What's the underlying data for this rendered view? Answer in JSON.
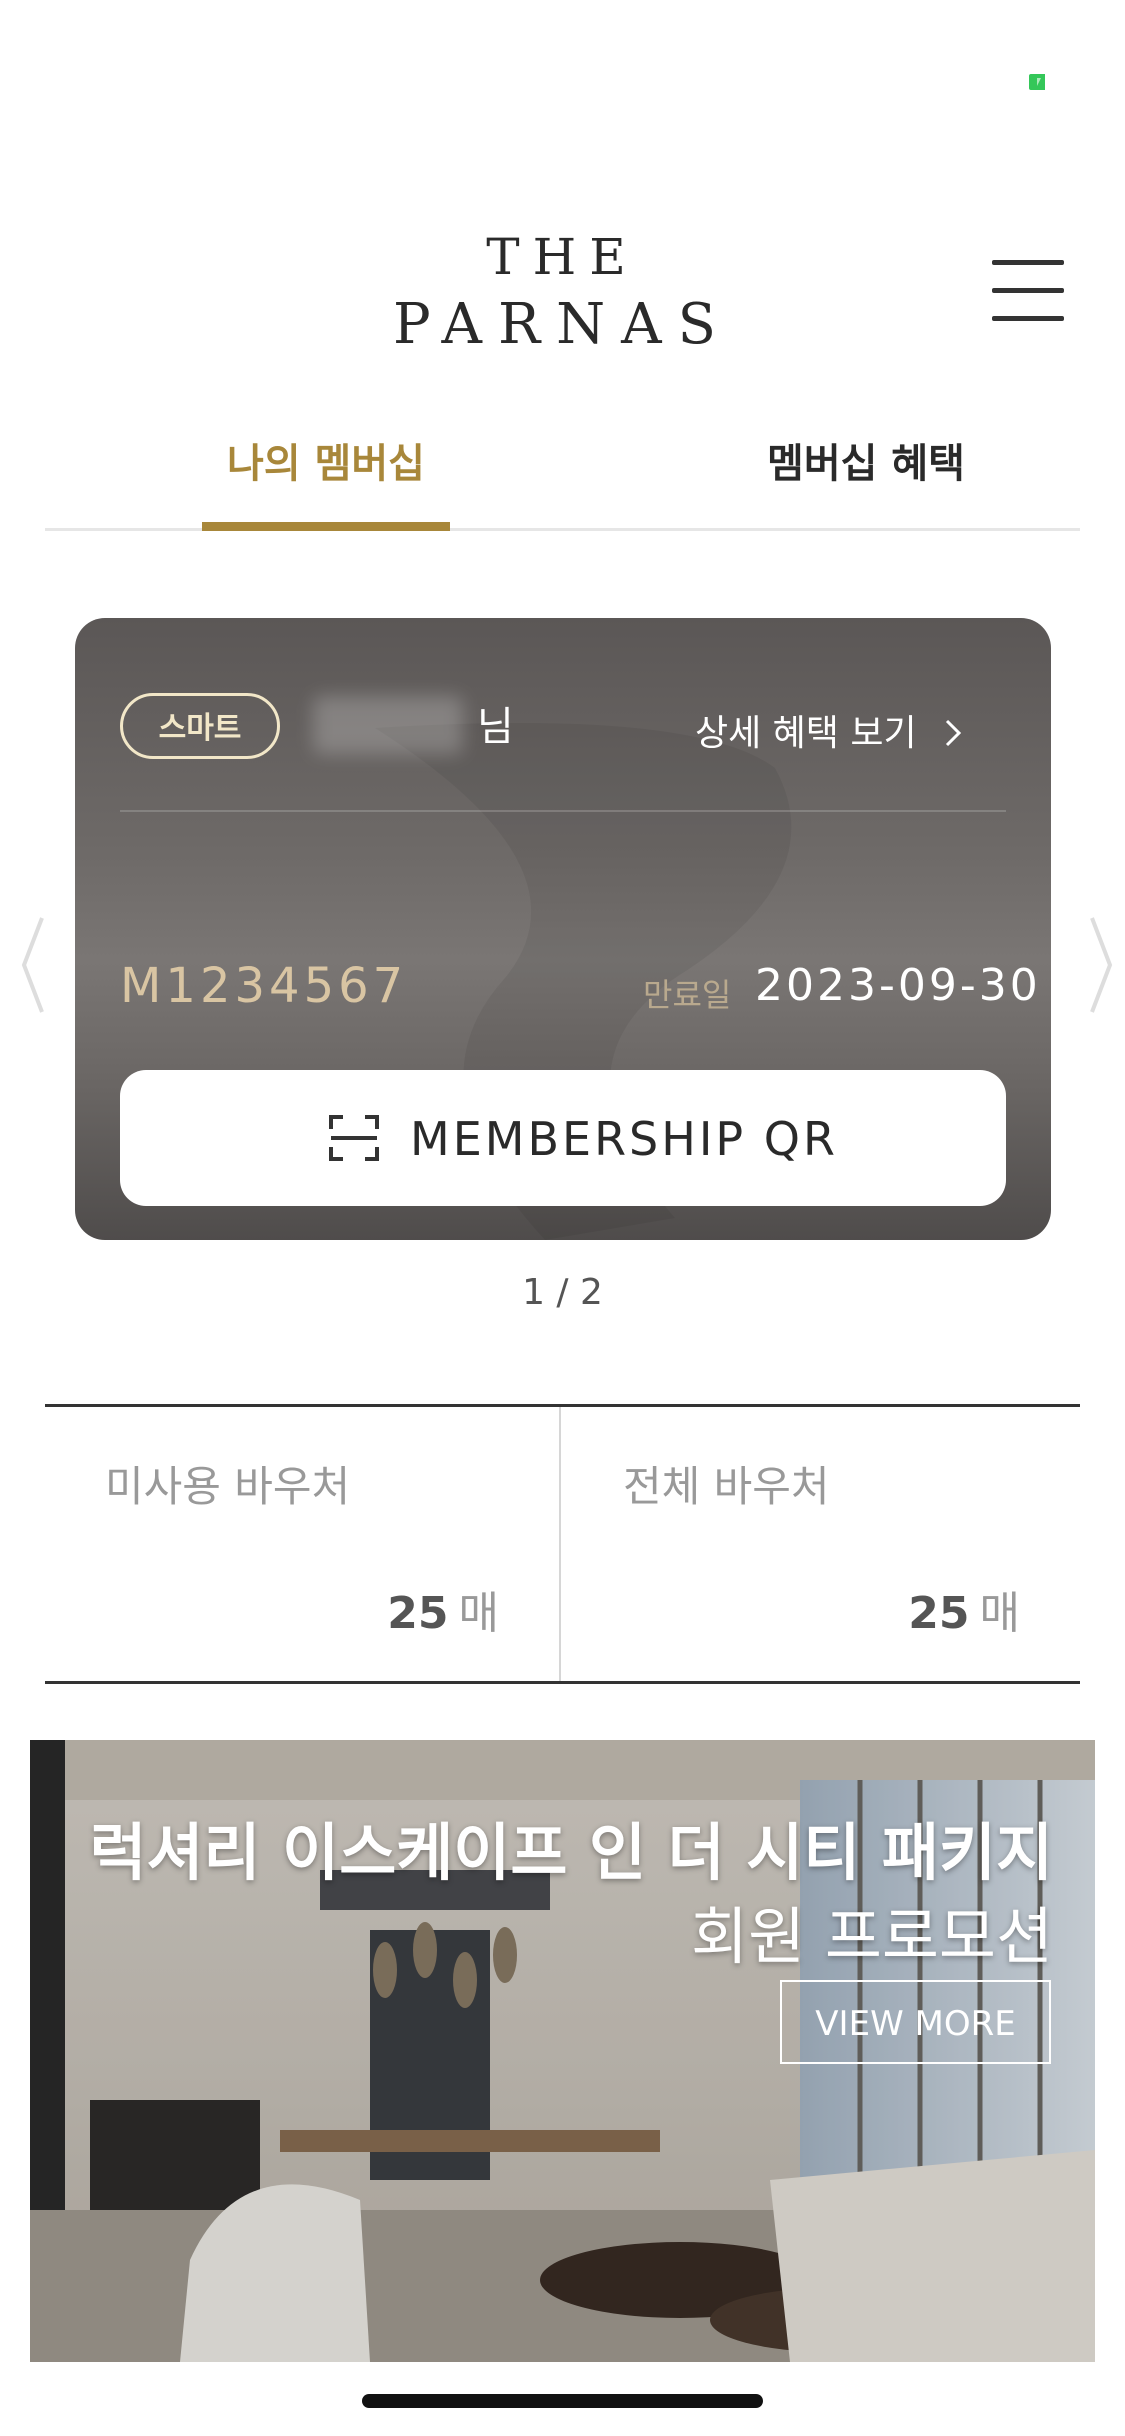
{
  "header": {
    "logo_line1": "THE",
    "logo_line2": "PARNAS"
  },
  "tabs": [
    {
      "label": "나의 멤버십",
      "active": true
    },
    {
      "label": "멤버십 혜택",
      "active": false
    }
  ],
  "membership_card": {
    "grade": "스마트",
    "name_suffix": "님",
    "detail_link": "상세 혜택 보기",
    "member_number": "M1234567",
    "expiry_label": "만료일",
    "expiry_date": "2023-09-30",
    "qr_button": "MEMBERSHIP QR"
  },
  "pager": "1 / 2",
  "vouchers": {
    "unused": {
      "label": "미사용 바우처",
      "count": "25",
      "unit": "매"
    },
    "total": {
      "label": "전체 바우처",
      "count": "25",
      "unit": "매"
    }
  },
  "banner": {
    "title": "럭셔리 이스케이프 인 더 시티 패키지",
    "subtitle": "회원 프로모션",
    "button": "VIEW MORE"
  },
  "colors": {
    "accent_gold": "#a8873a",
    "badge_cream": "#f2e7c8",
    "status_green": "#34c759"
  },
  "icons": [
    "battery-icon",
    "hamburger-menu-icon",
    "chevron-right-icon",
    "qr-scan-icon",
    "chevron-left-icon"
  ]
}
